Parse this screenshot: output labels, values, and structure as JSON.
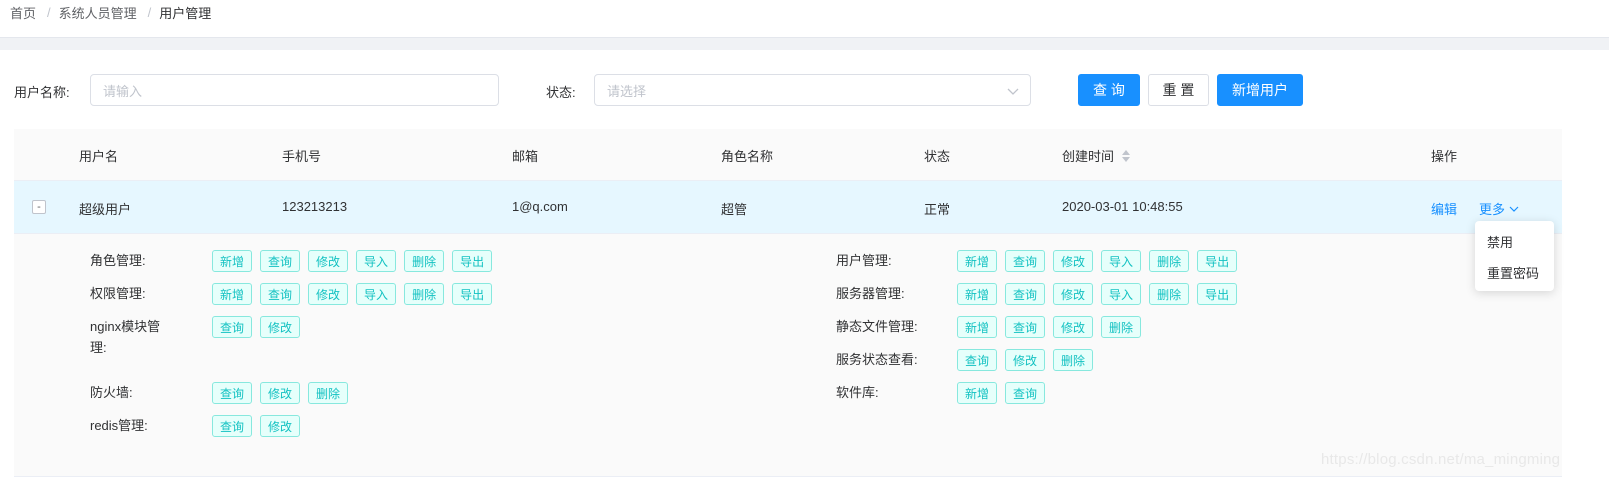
{
  "breadcrumb": {
    "items": [
      "首页",
      "系统人员管理",
      "用户管理"
    ]
  },
  "filters": {
    "username_label": "用户名称:",
    "username_placeholder": "请输入",
    "status_label": "状态:",
    "status_placeholder": "请选择",
    "search_button": "查 询",
    "reset_button": "重 置",
    "add_user_button": "新增用户"
  },
  "table": {
    "headers": {
      "username": "用户名",
      "phone": "手机号",
      "email": "邮箱",
      "role": "角色名称",
      "status": "状态",
      "created": "创建时间",
      "actions": "操作"
    },
    "row": {
      "expand_symbol": "-",
      "username": "超级用户",
      "phone": "123213213",
      "email": "1@q.com",
      "role": "超管",
      "status": "正常",
      "created": "2020-03-01 10:48:55",
      "edit": "编辑",
      "more": "更多"
    }
  },
  "permissions": {
    "left": [
      {
        "label": "角色管理:",
        "tags": [
          "新增",
          "查询",
          "修改",
          "导入",
          "删除",
          "导出"
        ]
      },
      {
        "label": "权限管理:",
        "tags": [
          "新增",
          "查询",
          "修改",
          "导入",
          "删除",
          "导出"
        ]
      },
      {
        "label_line1": "nginx模块管",
        "label_line2": "理:",
        "tags": [
          "查询",
          "修改"
        ]
      },
      {
        "label": "防火墙:",
        "tags": [
          "查询",
          "修改",
          "删除"
        ]
      },
      {
        "label": "redis管理:",
        "tags": [
          "查询",
          "修改"
        ]
      }
    ],
    "right": [
      {
        "label": "用户管理:",
        "tags": [
          "新增",
          "查询",
          "修改",
          "导入",
          "删除",
          "导出"
        ]
      },
      {
        "label": "服务器管理:",
        "tags": [
          "新增",
          "查询",
          "修改",
          "导入",
          "删除",
          "导出"
        ]
      },
      {
        "label": "静态文件管理:",
        "tags": [
          "新增",
          "查询",
          "修改",
          "删除"
        ]
      },
      {
        "label": "服务状态查看:",
        "tags": [
          "查询",
          "修改",
          "删除"
        ]
      },
      {
        "label": "软件库:",
        "tags": [
          "新增",
          "查询"
        ]
      }
    ]
  },
  "dropdown": {
    "items": [
      "禁用",
      "重置密码"
    ]
  },
  "watermark": "https://blog.csdn.net/ma_mingming",
  "colors": {
    "primary": "#1890ff",
    "tag_border": "#87e8de",
    "tag_bg": "#e6fffb",
    "tag_text": "#13c2c2",
    "row_highlight": "#e6f7ff"
  }
}
